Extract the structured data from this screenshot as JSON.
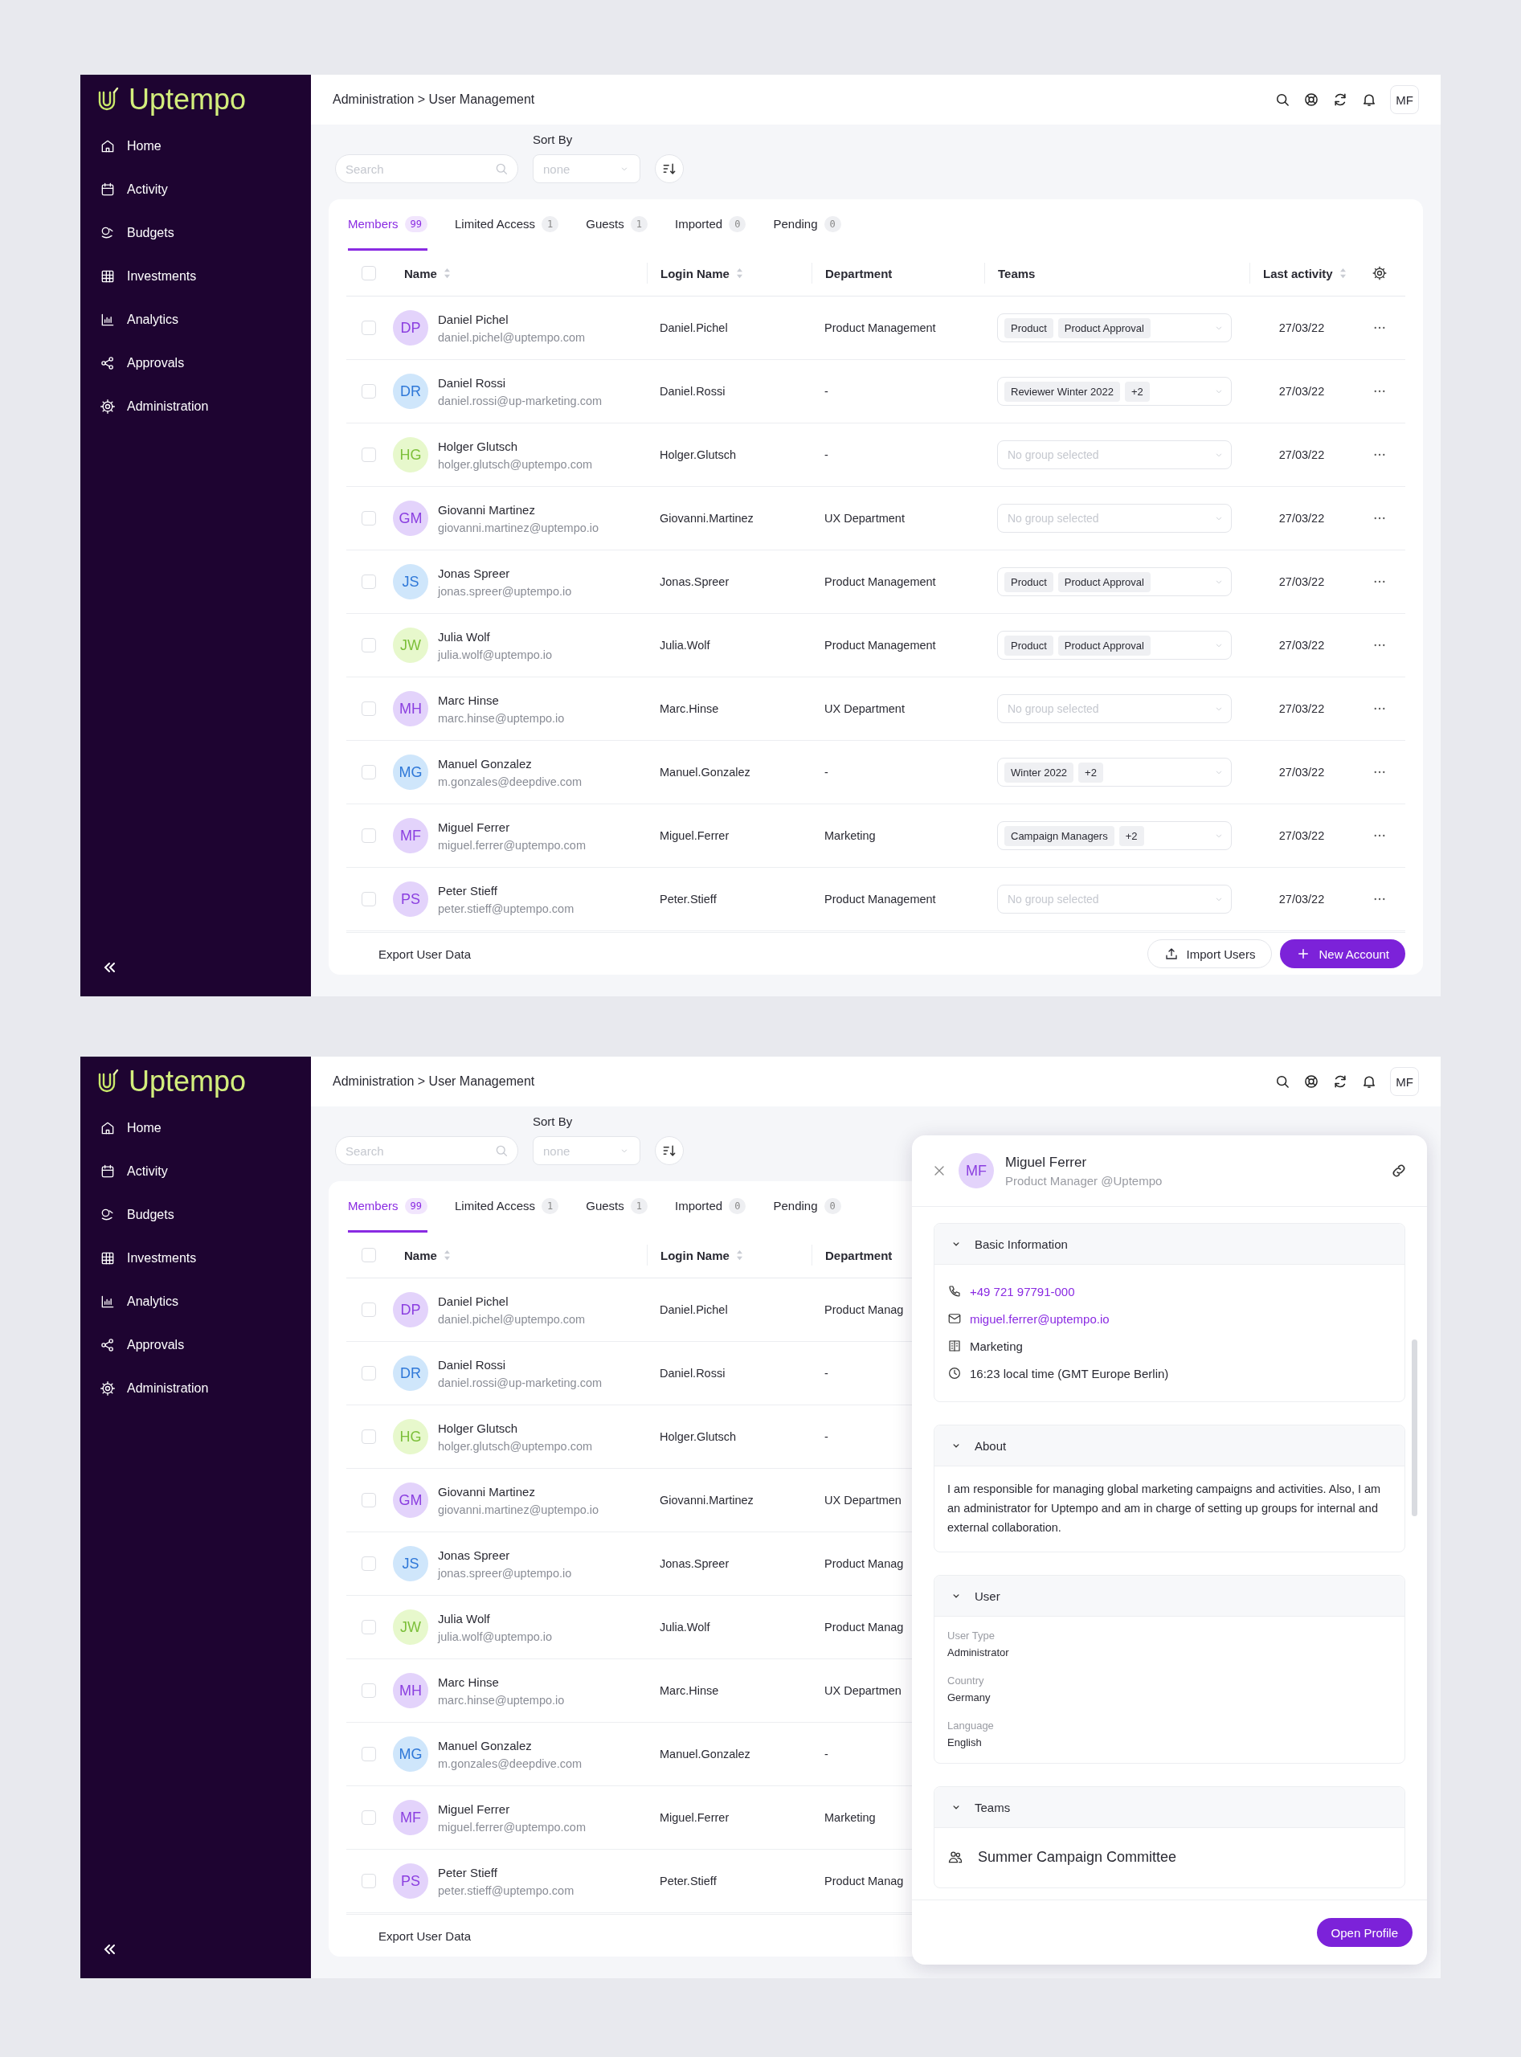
{
  "screens": [
    {
      "sidebar": {
        "logo": "Uptempo",
        "items": [
          {
            "label": "Home",
            "selected": false
          },
          {
            "label": "Activity",
            "selected": false
          },
          {
            "label": "Budgets",
            "selected": false
          },
          {
            "label": "Investments",
            "selected": false
          },
          {
            "label": "Analytics",
            "selected": false
          },
          {
            "label": "Approvals",
            "selected": false
          },
          {
            "label": "Administration",
            "selected": false
          }
        ]
      },
      "breadcrumb": "Administration > User Management",
      "user_initials": "MF",
      "search": {
        "placeholder": "Search"
      },
      "sort": {
        "label": "Sort By",
        "placeholder": "none"
      },
      "tabs": [
        {
          "label": "Members",
          "count": "99",
          "selected": true
        },
        {
          "label": "Limited Access",
          "count": "1",
          "selected": false
        },
        {
          "label": "Guests",
          "count": "1",
          "selected": false
        },
        {
          "label": "Imported",
          "count": "0",
          "selected": false
        },
        {
          "label": "Pending",
          "count": "0",
          "selected": false
        }
      ],
      "header_checkbox": {
        "checked": false
      },
      "columns": [
        {
          "label": "Name",
          "sortable": true
        },
        {
          "label": "Login Name",
          "sortable": true
        },
        {
          "label": "Department",
          "sortable": false
        },
        {
          "label": "Teams",
          "sortable": false
        },
        {
          "label": "Last activity",
          "sortable": true
        }
      ],
      "rows": [
        {
          "checked": false,
          "initials": "DP",
          "color": "#e3d3fb",
          "name": "Daniel Pichel",
          "email": "daniel.pichel@uptempo.com",
          "login": "Daniel.Pichel",
          "department": "Product Management",
          "teams": [
            "Product",
            "Product Approval"
          ],
          "last_activity": "27/03/22"
        },
        {
          "checked": false,
          "initials": "DR",
          "color": "#cfe6fb",
          "name": "Daniel Rossi",
          "email": "daniel.rossi@up-marketing.com",
          "login": "Daniel.Rossi",
          "department": "-",
          "teams": [
            "Reviewer Winter 2022",
            "+2"
          ],
          "last_activity": "27/03/22"
        },
        {
          "checked": false,
          "initials": "HG",
          "color": "#e7f8cc",
          "name": "Holger Glutsch",
          "email": "holger.glutsch@uptempo.com",
          "login": "Holger.Glutsch",
          "department": "-",
          "teams_placeholder": "No group selected",
          "last_activity": "27/03/22"
        },
        {
          "checked": false,
          "initials": "GM",
          "color": "#e3d3fb",
          "name": "Giovanni Martinez",
          "email": "giovanni.martinez@uptempo.io",
          "login": "Giovanni.Martinez",
          "department": "UX Department",
          "teams_placeholder": "No group selected",
          "last_activity": "27/03/22"
        },
        {
          "checked": false,
          "initials": "JS",
          "color": "#cfe6fb",
          "name": "Jonas Spreer",
          "email": "jonas.spreer@uptempo.io",
          "login": "Jonas.Spreer",
          "department": "Product Management",
          "teams": [
            "Product",
            "Product Approval"
          ],
          "last_activity": "27/03/22"
        },
        {
          "checked": false,
          "initials": "JW",
          "color": "#e7f8cc",
          "name": "Julia Wolf",
          "email": "julia.wolf@uptempo.io",
          "login": "Julia.Wolf",
          "department": "Product Management",
          "teams": [
            "Product",
            "Product Approval"
          ],
          "last_activity": "27/03/22"
        },
        {
          "checked": false,
          "initials": "MH",
          "color": "#e3d3fb",
          "name": "Marc Hinse",
          "email": "marc.hinse@uptempo.io",
          "login": "Marc.Hinse",
          "department": "UX Department",
          "teams_placeholder": "No group selected",
          "last_activity": "27/03/22"
        },
        {
          "checked": false,
          "initials": "MG",
          "color": "#cfe6fb",
          "name": "Manuel Gonzalez",
          "email": "m.gonzales@deepdive.com",
          "login": "Manuel.Gonzalez",
          "department": "-",
          "teams": [
            "Winter 2022",
            "+2"
          ],
          "last_activity": "27/03/22"
        },
        {
          "checked": false,
          "initials": "MF",
          "color": "#e3d3fb",
          "name": "Miguel Ferrer",
          "email": "miguel.ferrer@uptempo.com",
          "login": "Miguel.Ferrer",
          "department": "Marketing",
          "teams": [
            "Campaign Managers",
            "+2"
          ],
          "last_activity": "27/03/22"
        },
        {
          "checked": false,
          "initials": "PS",
          "color": "#e3d3fb",
          "name": "Peter Stieff",
          "email": "peter.stieff@uptempo.com",
          "login": "Peter.Stieff",
          "department": "Product Management",
          "teams_placeholder": "No group selected",
          "last_activity": "27/03/22"
        }
      ],
      "footer": {
        "export": "Export User Data",
        "import": "Import Users",
        "new_account": "New Account"
      }
    },
    {
      "sidebar": {
        "logo": "Uptempo",
        "items": [
          {
            "label": "Home",
            "selected": false
          },
          {
            "label": "Activity",
            "selected": false
          },
          {
            "label": "Budgets",
            "selected": false
          },
          {
            "label": "Investments",
            "selected": false
          },
          {
            "label": "Analytics",
            "selected": false
          },
          {
            "label": "Approvals",
            "selected": false
          },
          {
            "label": "Administration",
            "selected": false
          }
        ]
      },
      "breadcrumb": "Administration > User Management",
      "user_initials": "MF",
      "search": {
        "placeholder": "Search"
      },
      "sort": {
        "label": "Sort By",
        "placeholder": "none"
      },
      "tabs": [
        {
          "label": "Members",
          "count": "99",
          "selected": true
        },
        {
          "label": "Limited Access",
          "count": "1",
          "selected": false
        },
        {
          "label": "Guests",
          "count": "1",
          "selected": false
        },
        {
          "label": "Imported",
          "count": "0",
          "selected": false
        },
        {
          "label": "Pending",
          "count": "0",
          "selected": false
        }
      ],
      "header_checkbox": {
        "checked": false
      },
      "columns": [
        {
          "label": "Name",
          "sortable": true
        },
        {
          "label": "Login Name",
          "sortable": true
        },
        {
          "label": "Department",
          "sortable": false
        }
      ],
      "rows": [
        {
          "checked": false,
          "initials": "DP",
          "color": "#e3d3fb",
          "name": "Daniel Pichel",
          "email": "daniel.pichel@uptempo.com",
          "login": "Daniel.Pichel",
          "department": "Product Manag"
        },
        {
          "checked": false,
          "initials": "DR",
          "color": "#cfe6fb",
          "name": "Daniel Rossi",
          "email": "daniel.rossi@up-marketing.com",
          "login": "Daniel.Rossi",
          "department": "-"
        },
        {
          "checked": false,
          "initials": "HG",
          "color": "#e7f8cc",
          "name": "Holger Glutsch",
          "email": "holger.glutsch@uptempo.com",
          "login": "Holger.Glutsch",
          "department": "-"
        },
        {
          "checked": false,
          "initials": "GM",
          "color": "#e3d3fb",
          "name": "Giovanni Martinez",
          "email": "giovanni.martinez@uptempo.io",
          "login": "Giovanni.Martinez",
          "department": "UX Departmen"
        },
        {
          "checked": false,
          "initials": "JS",
          "color": "#cfe6fb",
          "name": "Jonas Spreer",
          "email": "jonas.spreer@uptempo.io",
          "login": "Jonas.Spreer",
          "department": "Product Manag"
        },
        {
          "checked": false,
          "initials": "JW",
          "color": "#e7f8cc",
          "name": "Julia Wolf",
          "email": "julia.wolf@uptempo.io",
          "login": "Julia.Wolf",
          "department": "Product Manag"
        },
        {
          "checked": false,
          "initials": "MH",
          "color": "#e3d3fb",
          "name": "Marc Hinse",
          "email": "marc.hinse@uptempo.io",
          "login": "Marc.Hinse",
          "department": "UX Departmen"
        },
        {
          "checked": false,
          "initials": "MG",
          "color": "#cfe6fb",
          "name": "Manuel Gonzalez",
          "email": "m.gonzales@deepdive.com",
          "login": "Manuel.Gonzalez",
          "department": "-"
        },
        {
          "checked": false,
          "initials": "MF",
          "color": "#e3d3fb",
          "name": "Miguel Ferrer",
          "email": "miguel.ferrer@uptempo.com",
          "login": "Miguel.Ferrer",
          "department": "Marketing"
        },
        {
          "checked": false,
          "initials": "PS",
          "color": "#e3d3fb",
          "name": "Peter Stieff",
          "email": "peter.stieff@uptempo.com",
          "login": "Peter.Stieff",
          "department": "Product Manag"
        }
      ],
      "footer": {
        "export": "Export User Data"
      },
      "profile_panel": {
        "initials": "MF",
        "color": "#e3d3fb",
        "name": "Miguel Ferrer",
        "subtitle": "Product Manager @Uptempo",
        "sections": [
          {
            "kind": "contacts",
            "title": "Basic Information",
            "expanded": true,
            "items": [
              {
                "kind": "phone",
                "text": "+49 721 97791-000",
                "link": true
              },
              {
                "kind": "email",
                "text": "miguel.ferrer@uptempo.io",
                "link": true
              },
              {
                "kind": "department",
                "text": "Marketing",
                "link": false
              },
              {
                "kind": "time",
                "text": "16:23 local time (GMT Europe Berlin)",
                "link": false
              }
            ]
          },
          {
            "kind": "text",
            "title": "About",
            "expanded": true,
            "text": "I am responsible for managing global marketing campaigns and activities. Also, I am an administrator for Uptempo and am in charge of setting up groups for internal and external collaboration."
          },
          {
            "kind": "fields",
            "title": "User",
            "expanded": true,
            "fields": [
              {
                "label": "User Type",
                "value": "Administrator"
              },
              {
                "label": "Country",
                "value": "Germany"
              },
              {
                "label": "Language",
                "value": "English"
              }
            ]
          },
          {
            "kind": "teams",
            "title": "Teams",
            "expanded": true,
            "items": [
              "Summer Campaign Committee"
            ]
          }
        ],
        "button": "Open Profile"
      }
    }
  ]
}
